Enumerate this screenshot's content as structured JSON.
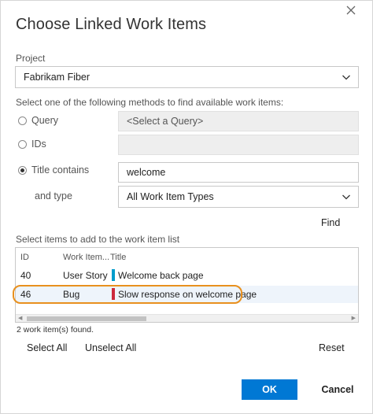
{
  "dialog": {
    "title": "Choose Linked Work Items"
  },
  "project": {
    "label": "Project",
    "value": "Fabrikam Fiber"
  },
  "methods": {
    "label": "Select one of the following methods to find available work items:",
    "query": {
      "label": "Query",
      "selected": false,
      "value": "<Select a Query>"
    },
    "ids": {
      "label": "IDs",
      "selected": false,
      "value": ""
    },
    "title_contains": {
      "label": "Title contains",
      "selected": true,
      "value": "welcome"
    },
    "type": {
      "label": "and type",
      "value": "All Work Item Types"
    }
  },
  "find_label": "Find",
  "list": {
    "label": "Select items to add to the work item list",
    "columns": [
      "ID",
      "Work Item...",
      "Title"
    ],
    "rows": [
      {
        "id": "40",
        "type": "User Story",
        "title": "Welcome back page",
        "color": "#009ccc"
      },
      {
        "id": "46",
        "type": "Bug",
        "title": "Slow response on welcome page",
        "color": "#cc293d"
      }
    ],
    "count": "2 work item(s) found."
  },
  "actions": {
    "select_all": "Select All",
    "unselect_all": "Unselect All",
    "reset": "Reset",
    "ok": "OK",
    "cancel": "Cancel"
  },
  "colors": {
    "primary": "#0078d4",
    "highlight": "#e8901e"
  }
}
